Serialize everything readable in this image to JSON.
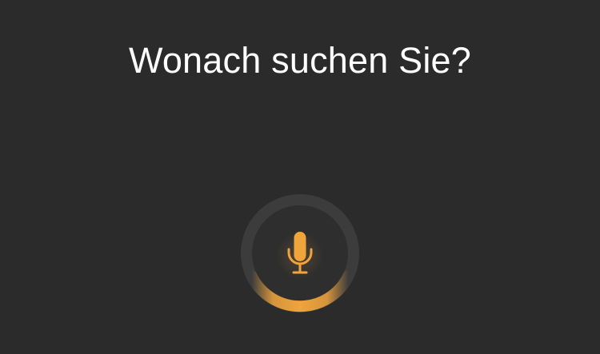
{
  "voice_search": {
    "prompt": "Wonach suchen Sie?",
    "mic_button": {
      "icon": "microphone-icon",
      "state": "listening"
    }
  },
  "colors": {
    "background": "#2b2b2b",
    "ring_track": "#3c3c3c",
    "accent": "#f0a43c",
    "text": "#ffffff"
  }
}
